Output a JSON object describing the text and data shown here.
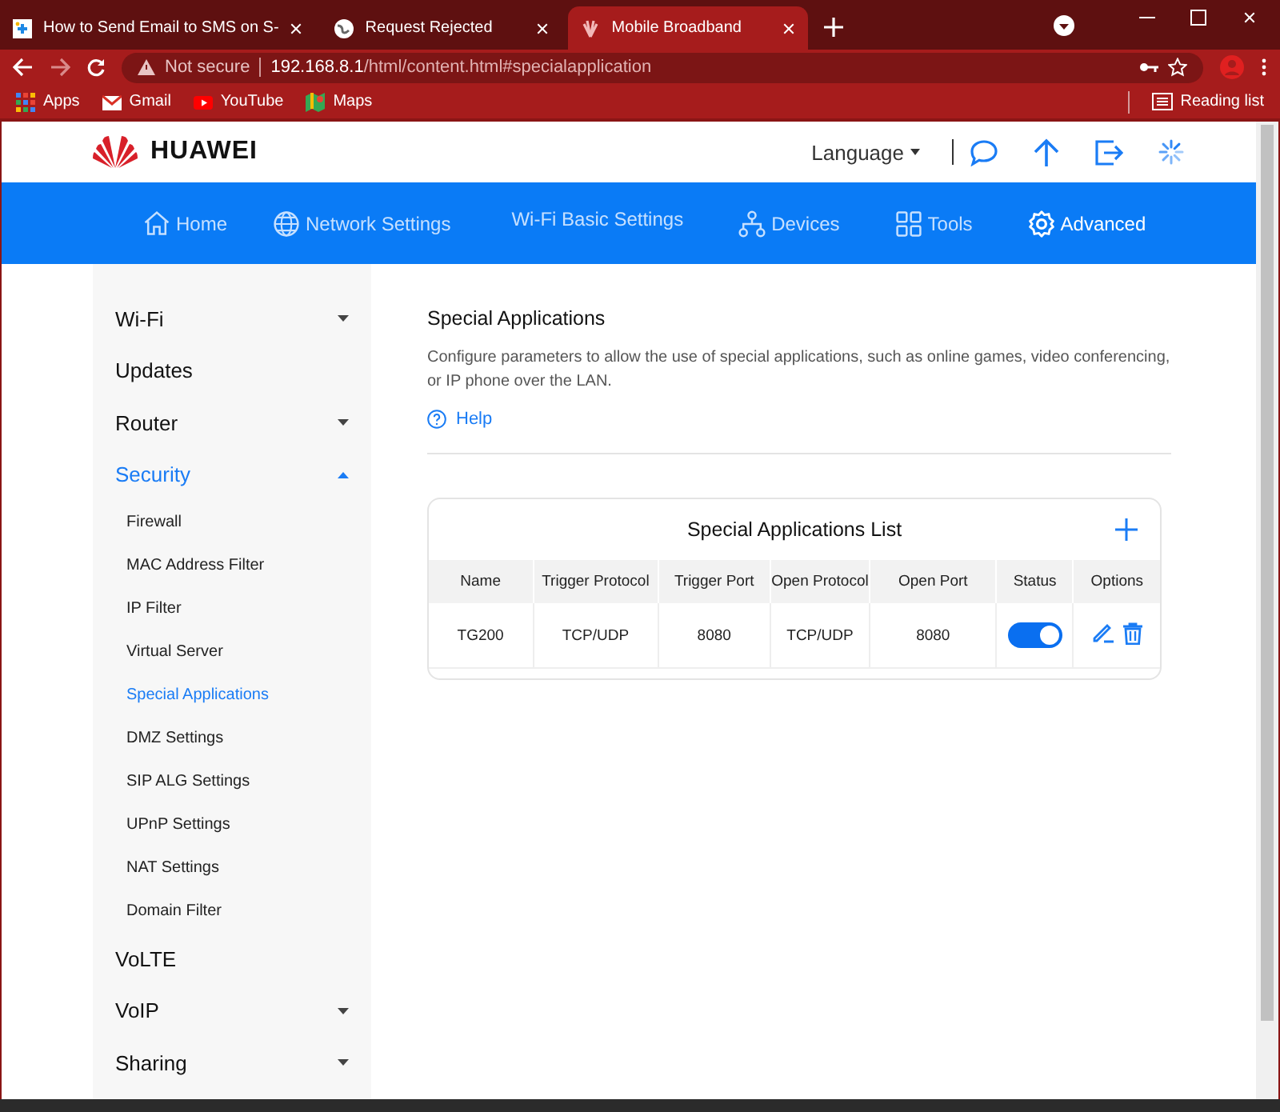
{
  "browser": {
    "tabs": [
      {
        "title": "How to Send Email to SMS on S-",
        "selected": false
      },
      {
        "title": "Request Rejected",
        "selected": false
      },
      {
        "title": "Mobile Broadband",
        "selected": true
      }
    ],
    "address": {
      "security": "Not secure",
      "host": "192.168.8.1",
      "path": "/html/content.html#specialapplication"
    },
    "bookmarks": [
      "Apps",
      "Gmail",
      "YouTube",
      "Maps"
    ],
    "reading_list": "Reading list"
  },
  "header": {
    "brand": "HUAWEI",
    "language": "Language"
  },
  "nav": [
    {
      "label": "Home",
      "selected": false
    },
    {
      "label": "Network Settings",
      "selected": false
    },
    {
      "label": "Wi-Fi Basic Settings",
      "selected": false
    },
    {
      "label": "Devices",
      "selected": false
    },
    {
      "label": "Tools",
      "selected": false
    },
    {
      "label": "Advanced",
      "selected": true
    }
  ],
  "sidebar": {
    "items": [
      {
        "label": "Wi-Fi",
        "selected": false,
        "expanded": false
      },
      {
        "label": "Updates",
        "selected": false
      },
      {
        "label": "Router",
        "selected": false,
        "expanded": false
      },
      {
        "label": "Security",
        "selected": true,
        "expanded": true,
        "children": [
          {
            "label": "Firewall",
            "selected": false
          },
          {
            "label": "MAC Address Filter",
            "selected": false
          },
          {
            "label": "IP Filter",
            "selected": false
          },
          {
            "label": "Virtual Server",
            "selected": false
          },
          {
            "label": "Special Applications",
            "selected": true
          },
          {
            "label": "DMZ Settings",
            "selected": false
          },
          {
            "label": "SIP ALG Settings",
            "selected": false
          },
          {
            "label": "UPnP Settings",
            "selected": false
          },
          {
            "label": "NAT Settings",
            "selected": false
          },
          {
            "label": "Domain Filter",
            "selected": false
          }
        ]
      },
      {
        "label": "VoLTE",
        "selected": false
      },
      {
        "label": "VoIP",
        "selected": false,
        "expanded": false
      },
      {
        "label": "Sharing",
        "selected": false,
        "expanded": false
      }
    ]
  },
  "content": {
    "title": "Special Applications",
    "description": "Configure parameters to allow the use of special applications, such as online games, video conferencing, or IP phone over the LAN.",
    "help": "Help",
    "list": {
      "title": "Special Applications List",
      "columns": [
        "Name",
        "Trigger Protocol",
        "Trigger Port",
        "Open Protocol",
        "Open Port",
        "Status",
        "Options"
      ],
      "rows": [
        {
          "cells": [
            "TG200",
            "TCP/UDP",
            "8080",
            "TCP/UDP",
            "8080"
          ],
          "enabled": true
        }
      ]
    }
  }
}
